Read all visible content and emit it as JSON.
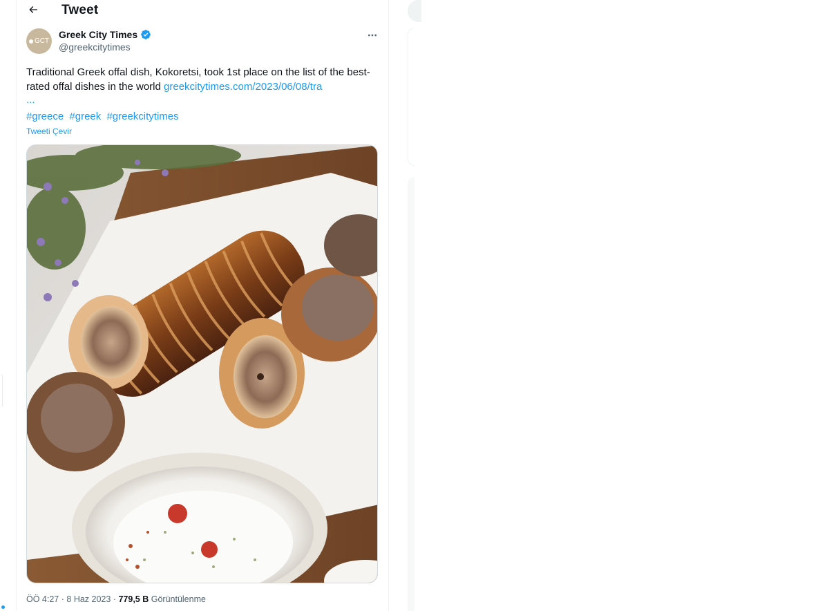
{
  "header": {
    "title": "Tweet"
  },
  "author": {
    "avatar_text": "GCT",
    "name": "Greek City Times",
    "handle": "@greekcitytimes"
  },
  "tweet": {
    "text_line1": "Traditional Greek offal dish, Kokoretsi, took 1st place on the list of the",
    "text_line2": "best-rated offal dishes in the world ",
    "link": "greekcitytimes.com/2023/06/08/tra",
    "link_ellipsis": "...",
    "hashtags": [
      "#greece",
      "#greek",
      "#greekcitytimes"
    ],
    "translate_label": "Tweeti Çevir"
  },
  "meta": {
    "time": "ÖÖ 4:27",
    "separator": "·",
    "date": "8 Haz 2023",
    "views_count": "779,5 B",
    "views_label": "Görüntülenme"
  },
  "colors": {
    "accent": "#1d9bf0",
    "text": "#0f1419",
    "muted": "#536471",
    "border": "#eff3f4"
  },
  "icons": {
    "back": "arrow-left-icon",
    "verified": "verified-badge-icon",
    "more": "more-horizontal-icon"
  }
}
